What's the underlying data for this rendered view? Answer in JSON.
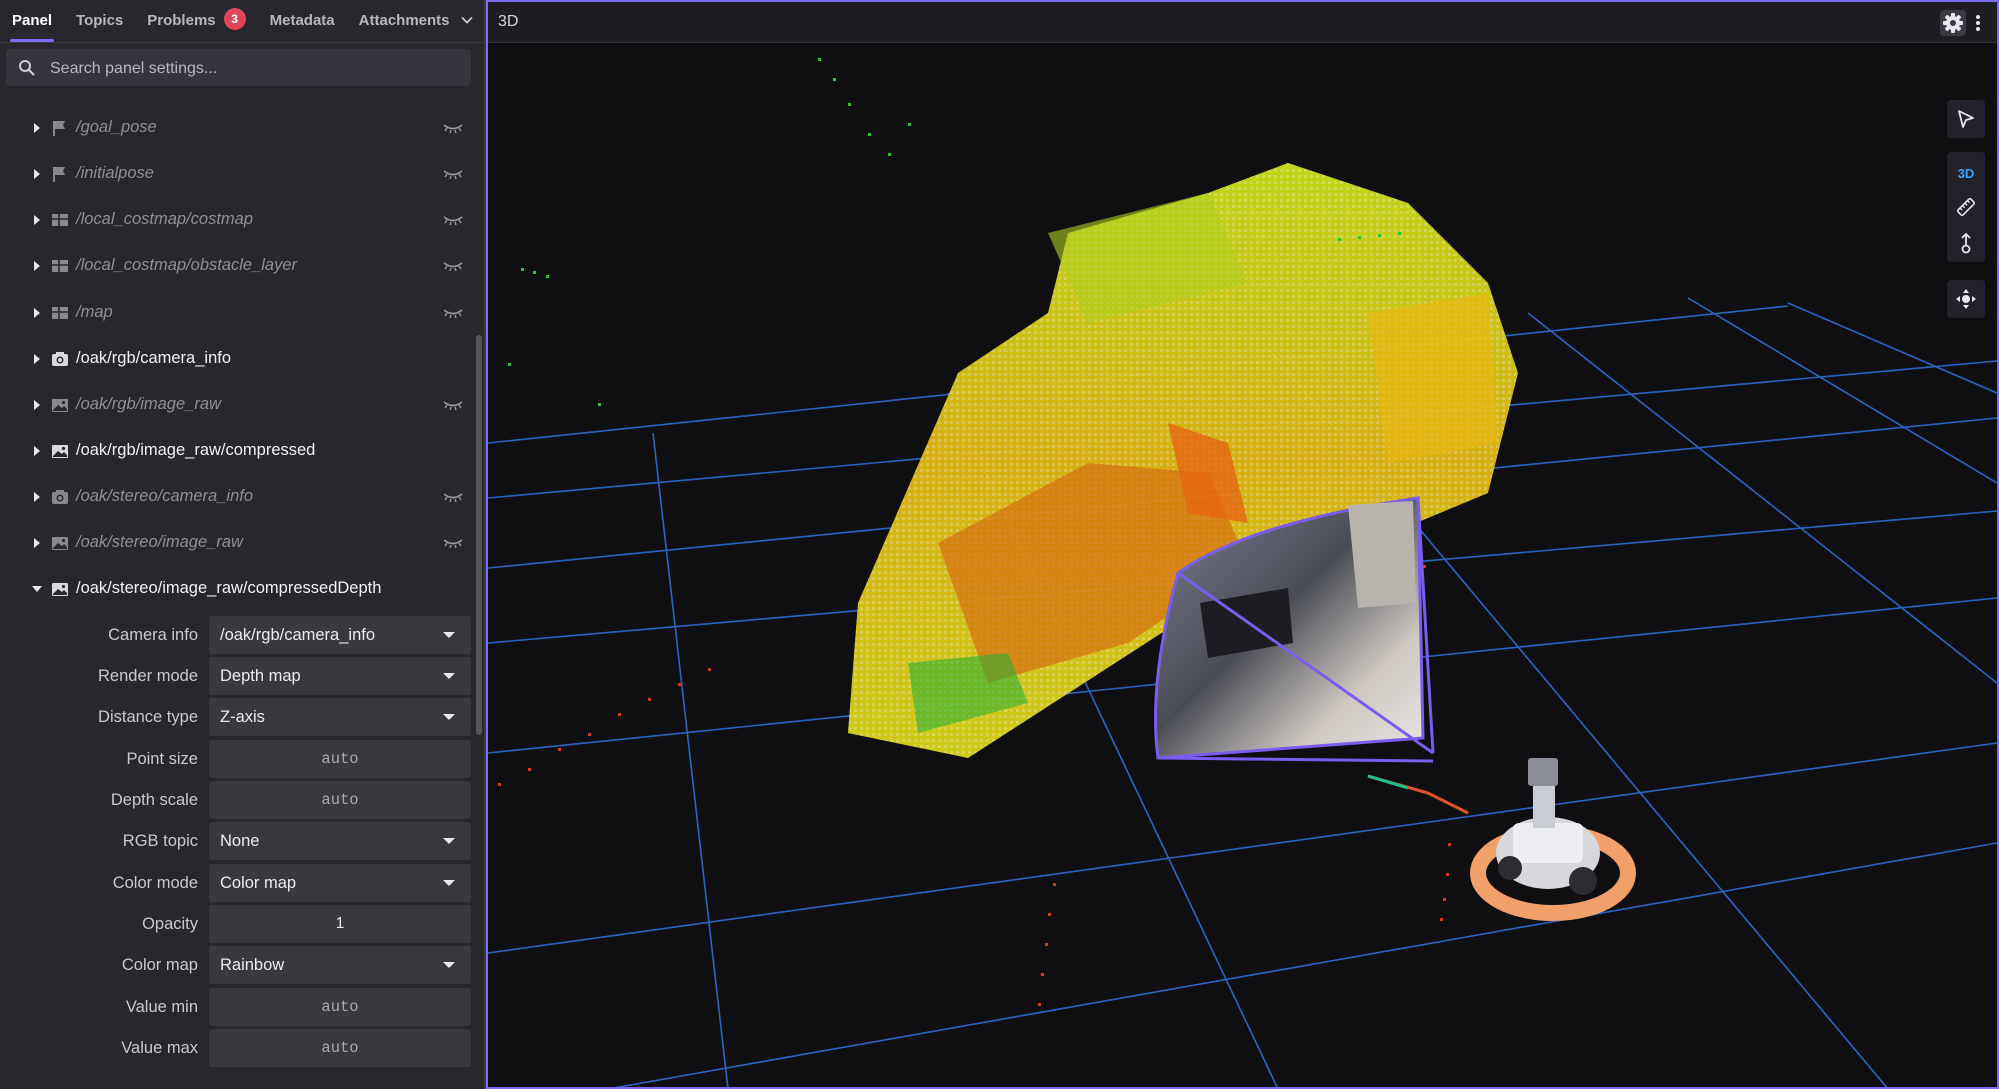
{
  "tabs": [
    {
      "label": "Panel"
    },
    {
      "label": "Topics"
    },
    {
      "label": "Problems",
      "badge": "3"
    },
    {
      "label": "Metadata"
    },
    {
      "label": "Attachments"
    }
  ],
  "search": {
    "placeholder": "Search panel settings..."
  },
  "topics": [
    {
      "label": "/goal_pose",
      "icon": "flag-icon",
      "visible": false
    },
    {
      "label": "/initialpose",
      "icon": "flag-icon",
      "visible": false
    },
    {
      "label": "/local_costmap/costmap",
      "icon": "grid-icon",
      "visible": false
    },
    {
      "label": "/local_costmap/obstacle_layer",
      "icon": "grid-icon",
      "visible": false
    },
    {
      "label": "/map",
      "icon": "grid-icon",
      "visible": false
    },
    {
      "label": "/oak/rgb/camera_info",
      "icon": "camera-icon",
      "visible": true
    },
    {
      "label": "/oak/rgb/image_raw",
      "icon": "image-icon",
      "visible": false
    },
    {
      "label": "/oak/rgb/image_raw/compressed",
      "icon": "image-icon",
      "visible": true
    },
    {
      "label": "/oak/stereo/camera_info",
      "icon": "camera-icon",
      "visible": false
    },
    {
      "label": "/oak/stereo/image_raw",
      "icon": "image-icon",
      "visible": false
    },
    {
      "label": "/oak/stereo/image_raw/compressedDepth",
      "icon": "image-icon",
      "visible": true,
      "expanded": true
    }
  ],
  "settings": [
    {
      "label": "Camera info",
      "value": "/oak/rgb/camera_info",
      "kind": "select"
    },
    {
      "label": "Render mode",
      "value": "Depth map",
      "kind": "select"
    },
    {
      "label": "Distance type",
      "value": "Z-axis",
      "kind": "select"
    },
    {
      "label": "Point size",
      "value": "auto",
      "kind": "input"
    },
    {
      "label": "Depth scale",
      "value": "auto",
      "kind": "input"
    },
    {
      "label": "RGB topic",
      "value": "None",
      "kind": "select"
    },
    {
      "label": "Color mode",
      "value": "Color map",
      "kind": "select"
    },
    {
      "label": "Opacity",
      "value": "1",
      "kind": "number"
    },
    {
      "label": "Color map",
      "value": "Rainbow",
      "kind": "select"
    },
    {
      "label": "Value min",
      "value": "auto",
      "kind": "input"
    },
    {
      "label": "Value max",
      "value": "auto",
      "kind": "input"
    }
  ],
  "viewport": {
    "title": "3D",
    "mode_label": "3D"
  },
  "colors": {
    "accent": "#7b6cff",
    "badge": "#e0465b",
    "grid": "#2f6fd6",
    "frustum": "#7a5cf0",
    "robot_ring": "#f2a06a"
  }
}
